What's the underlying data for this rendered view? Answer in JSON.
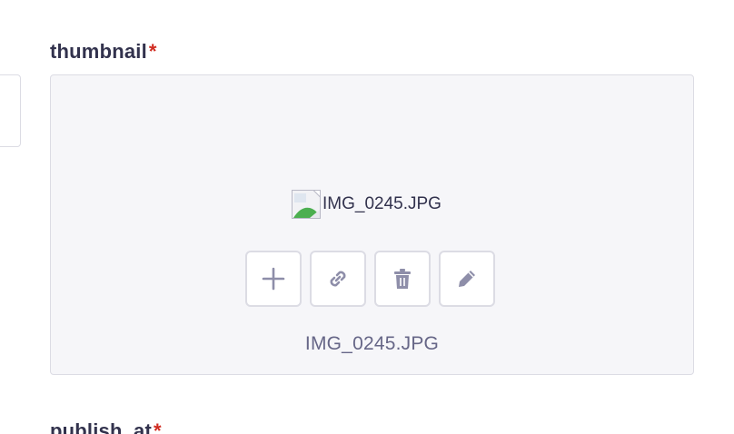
{
  "thumbnail_field": {
    "label": "thumbnail",
    "required_mark": "*",
    "preview_text": "IMG_0245.JPG",
    "filename": "IMG_0245.JPG",
    "actions": [
      {
        "icon": "plus-icon"
      },
      {
        "icon": "link-icon"
      },
      {
        "icon": "trash-icon"
      },
      {
        "icon": "pencil-icon"
      }
    ]
  },
  "publish_field": {
    "label": "publish_at",
    "required_mark": "*"
  },
  "colors": {
    "label": "#32324d",
    "required": "#d02b20",
    "box_background": "#f6f6f9",
    "border": "#dcdce4",
    "icon": "#8e8ea9",
    "filename": "#666687"
  }
}
